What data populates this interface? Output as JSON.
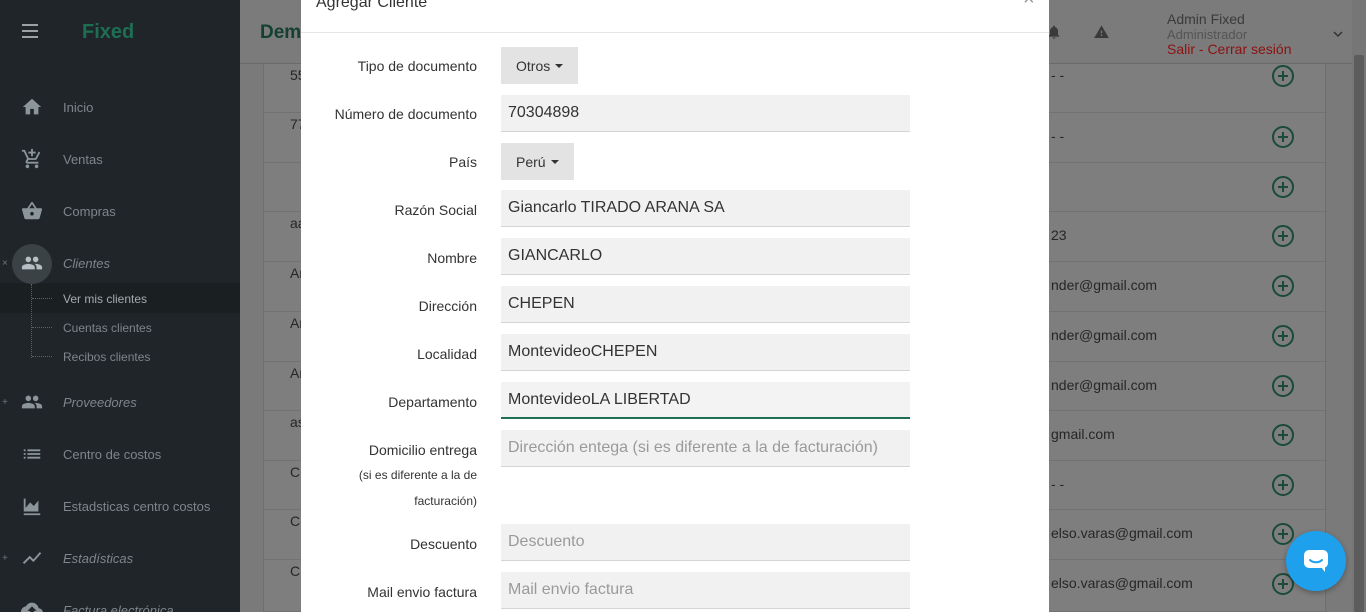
{
  "sidebar": {
    "brand": "Fixed",
    "items": [
      {
        "label": "Inicio",
        "icon": "home-icon"
      },
      {
        "label": "Ventas",
        "icon": "cart-add-icon"
      },
      {
        "label": "Compras",
        "icon": "basket-icon"
      },
      {
        "label": "Clientes",
        "icon": "people-icon"
      },
      {
        "label": "Proveedores",
        "icon": "people-outline-icon"
      },
      {
        "label": "Centro de costos",
        "icon": "list-icon"
      },
      {
        "label": "Estadsticas centro costos",
        "icon": "area-chart-icon"
      },
      {
        "label": "Estadísticas",
        "icon": "trend-chart-icon"
      },
      {
        "label": "Factura electrónica",
        "icon": "cloud-upload-icon"
      }
    ],
    "subitems": [
      "Ver mis clientes",
      "Cuentas clientes",
      "Recibos clientes"
    ]
  },
  "header": {
    "title": "Dem",
    "user_name": "Admin Fixed",
    "user_role": "Administrador",
    "logout": "Salir - Cerrar sesión"
  },
  "table": {
    "rows": [
      {
        "c1": "55",
        "c2": "- -"
      },
      {
        "c1": "77",
        "c2": "- -"
      },
      {
        "c1": "",
        "c2": ""
      },
      {
        "c1": "aa",
        "c2": "23"
      },
      {
        "c1": "Ar",
        "c2": "nder@gmail.com"
      },
      {
        "c1": "Ar",
        "c2": "nder@gmail.com"
      },
      {
        "c1": "Ar",
        "c2": "nder@gmail.com"
      },
      {
        "c1": "as",
        "c2": "gmail.com"
      },
      {
        "c1": "C",
        "c2": "- -"
      },
      {
        "c1": "C",
        "c2": "elso.varas@gmail.com"
      },
      {
        "c1": "C",
        "c2": "elso.varas@gmail.com"
      }
    ]
  },
  "modal": {
    "title": "Agregar Cliente",
    "close": "×",
    "fields": {
      "tipo_documento": {
        "label": "Tipo de documento",
        "value": "Otros"
      },
      "numero_documento": {
        "label": "Número de documento",
        "value": "70304898"
      },
      "pais": {
        "label": "País",
        "value": "Perú"
      },
      "razon_social": {
        "label": "Razón Social",
        "value": "Giancarlo TIRADO ARANA SA"
      },
      "nombre": {
        "label": "Nombre",
        "value": "GIANCARLO"
      },
      "direccion": {
        "label": "Dirección",
        "value": "CHEPEN"
      },
      "localidad": {
        "label": "Localidad",
        "value": "MontevideoCHEPEN"
      },
      "departamento": {
        "label": "Departamento",
        "value": "MontevideoLA LIBERTAD"
      },
      "domicilio_entrega": {
        "label": "Domicilio entrega",
        "note_1": "(si es diferente a la de",
        "note_2": "facturación)",
        "placeholder": "Dirección entega (si es diferente a la de facturación)"
      },
      "descuento": {
        "label": "Descuento",
        "placeholder": "Descuento"
      },
      "mail_envio": {
        "label": "Mail envio factura",
        "placeholder": "Mail envio factura"
      }
    }
  },
  "colors": {
    "sidebar_bg": "#1f2529",
    "accent_green": "#1e6f52",
    "logout_red": "#8d1212",
    "chat_blue": "#1ea0ec"
  }
}
